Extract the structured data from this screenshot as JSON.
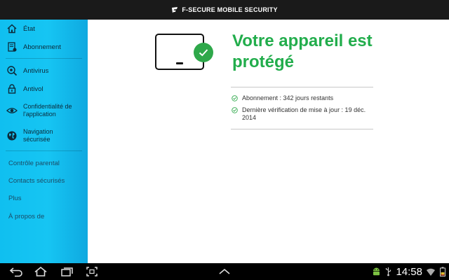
{
  "app": {
    "title": "F-SECURE MOBILE SECURITY"
  },
  "sidebar": {
    "items": [
      {
        "label": "État",
        "icon": "home-icon"
      },
      {
        "label": "Abonnement",
        "icon": "subscription-icon"
      },
      {
        "label": "Antivirus",
        "icon": "antivirus-icon"
      },
      {
        "label": "Antivol",
        "icon": "lock-icon"
      },
      {
        "label": "Confidentialité de l'application",
        "icon": "eye-icon"
      },
      {
        "label": "Navigation sécurisée",
        "icon": "globe-icon"
      }
    ],
    "plain_items": [
      {
        "label": "Contrôle parental"
      },
      {
        "label": "Contacts sécurisés"
      },
      {
        "label": "Plus"
      },
      {
        "label": "À propos de"
      }
    ]
  },
  "main": {
    "status_title": "Votre appareil est protégé",
    "info": [
      {
        "text": "Abonnement : 342 jours restants"
      },
      {
        "text": "Dernière vérification de mise à jour : 19 déc. 2014"
      }
    ]
  },
  "system_bar": {
    "time": "14:58",
    "icons": [
      "back-icon",
      "home-icon",
      "recent-apps-icon",
      "screenshot-icon",
      "up-arrow-icon",
      "android-notification-icon",
      "usb-icon",
      "wifi-icon",
      "battery-icon"
    ]
  },
  "colors": {
    "accent_green": "#22ad4c",
    "sidebar_blue": "#16c5f3",
    "badge_green": "#2ea84a"
  }
}
